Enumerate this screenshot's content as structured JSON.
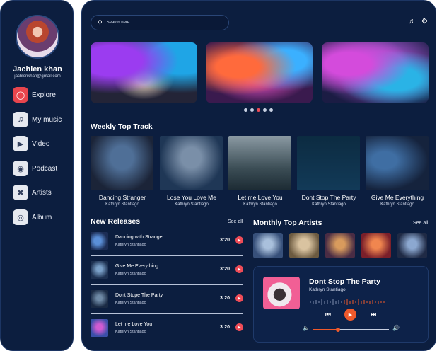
{
  "user": {
    "name": "Jachlen khan",
    "email": "jachlenkhan@gmail.com"
  },
  "nav": [
    {
      "label": "Explore",
      "icon": "compass-icon",
      "active": true
    },
    {
      "label": "My music",
      "icon": "music-library-icon",
      "active": false
    },
    {
      "label": "Video",
      "icon": "video-icon",
      "active": false
    },
    {
      "label": "Podcast",
      "icon": "podcast-icon",
      "active": false
    },
    {
      "label": "Artists",
      "icon": "artists-icon",
      "active": false
    },
    {
      "label": "Album",
      "icon": "album-icon",
      "active": false
    }
  ],
  "search": {
    "placeholder": "Search here..........................."
  },
  "carousel": {
    "dots": 5,
    "active_index": 2
  },
  "weekly": {
    "title": "Weekly Top Track",
    "tracks": [
      {
        "title": "Dancing Stranger",
        "artist": "Kathryn Stantiago"
      },
      {
        "title": "Lose You Love Me",
        "artist": "Kathryn Stantiago"
      },
      {
        "title": "Let me Love You",
        "artist": "Kathryn Stantiago"
      },
      {
        "title": "Dont Stop The Party",
        "artist": "Kathryn Stantiago"
      },
      {
        "title": "Give Me Everything",
        "artist": "Kathryn Stantiago"
      }
    ]
  },
  "new_releases": {
    "title": "New Releases",
    "see_all": "See all",
    "items": [
      {
        "title": "Dancing with Stranger",
        "artist": "Kathryn Stantiago",
        "duration": "3:20"
      },
      {
        "title": "Give Me Everything",
        "artist": "Kathryn Stantiago",
        "duration": "3:20"
      },
      {
        "title": "Dont Stope The Party",
        "artist": "Kathryn Stantiago",
        "duration": "3:20"
      },
      {
        "title": "Let me Love You",
        "artist": "Kathryn Stantiago",
        "duration": "3:20"
      }
    ]
  },
  "monthly": {
    "title": "Monthly Top Artists",
    "see_all": "See all"
  },
  "player": {
    "title": "Dont Stop The Party",
    "artist": "Kathryn Stantiago",
    "volume": 0.33
  },
  "colors": {
    "accent": "#ef4c57",
    "player_accent": "#ef5a2c",
    "panel": "#0c1e3f"
  }
}
